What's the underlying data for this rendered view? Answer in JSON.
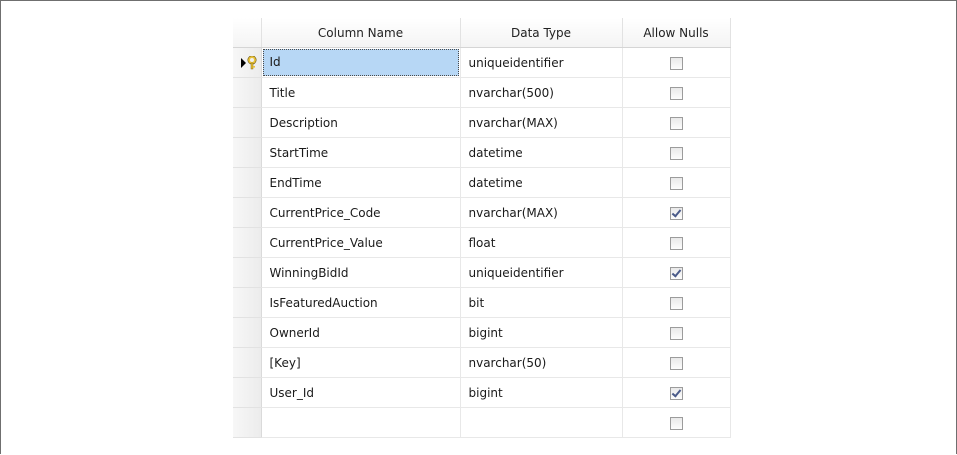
{
  "table_designer": {
    "headers": {
      "column_name": "Column Name",
      "data_type": "Data Type",
      "allow_nulls": "Allow Nulls"
    },
    "rows": [
      {
        "column_name": "Id",
        "data_type": "uniqueidentifier",
        "allow_nulls": false,
        "primary_key": true,
        "active": true
      },
      {
        "column_name": "Title",
        "data_type": "nvarchar(500)",
        "allow_nulls": false
      },
      {
        "column_name": "Description",
        "data_type": "nvarchar(MAX)",
        "allow_nulls": false
      },
      {
        "column_name": "StartTime",
        "data_type": "datetime",
        "allow_nulls": false
      },
      {
        "column_name": "EndTime",
        "data_type": "datetime",
        "allow_nulls": false
      },
      {
        "column_name": "CurrentPrice_Code",
        "data_type": "nvarchar(MAX)",
        "allow_nulls": true
      },
      {
        "column_name": "CurrentPrice_Value",
        "data_type": "float",
        "allow_nulls": false
      },
      {
        "column_name": "WinningBidId",
        "data_type": "uniqueidentifier",
        "allow_nulls": true
      },
      {
        "column_name": "IsFeaturedAuction",
        "data_type": "bit",
        "allow_nulls": false
      },
      {
        "column_name": "OwnerId",
        "data_type": "bigint",
        "allow_nulls": false
      },
      {
        "column_name": "[Key]",
        "data_type": "nvarchar(50)",
        "allow_nulls": false
      },
      {
        "column_name": "User_Id",
        "data_type": "bigint",
        "allow_nulls": true
      },
      {
        "column_name": "",
        "data_type": "",
        "allow_nulls": false
      }
    ],
    "icons": {
      "row_marker": "current-row-arrow-icon",
      "primary_key": "primary-key-icon"
    },
    "colors": {
      "selected_cell": "#b7d7f5",
      "key_icon": "#e8c23a",
      "checkmark": "#4b5b8a"
    }
  }
}
